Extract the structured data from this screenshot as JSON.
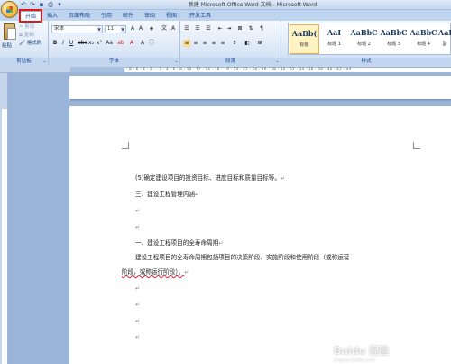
{
  "window": {
    "title": "新建 Microsoft Office Word 文档 - Microsoft Word"
  },
  "quick_access": [
    "undo-icon",
    "redo-icon",
    "save-icon",
    "print-icon",
    "customize-icon"
  ],
  "tabs": [
    {
      "label": "开始",
      "active": true
    },
    {
      "label": "插入"
    },
    {
      "label": "页面布局"
    },
    {
      "label": "引用"
    },
    {
      "label": "邮件"
    },
    {
      "label": "审阅"
    },
    {
      "label": "视图"
    },
    {
      "label": "开发工具"
    }
  ],
  "ribbon": {
    "clipboard": {
      "label": "剪贴板",
      "paste": "粘贴",
      "cut": "剪切",
      "copy": "复制",
      "format_painter": "格式刷"
    },
    "font": {
      "label": "字体",
      "font_name": "宋体",
      "font_size": "11"
    },
    "paragraph": {
      "label": "段落"
    },
    "styles": {
      "label": "样式",
      "items": [
        {
          "sample": "AaBb(",
          "name": "标题"
        },
        {
          "sample": "AaI",
          "name": "标题 1"
        },
        {
          "sample": "AaBbC",
          "name": "标题 2"
        },
        {
          "sample": "AaBbC",
          "name": "标题 3"
        },
        {
          "sample": "AaBbC",
          "name": "标题 4"
        },
        {
          "sample": "AaBb(",
          "name": "副"
        }
      ]
    }
  },
  "ruler_ticks": "· 8 · 6 · 4 · 2 ·  · 2 · 4 · 6 · 8 · 10 · 12 · 14 · 16 · 18 · 20 · 22 · 24 · 26 · 28 · 30 · 32 · 34 · 36 · 38 · 40 · 42 · 44",
  "document": {
    "paragraphs": [
      "(5)确定建设项目的投资目标、进度目标和质量目标等。",
      "三、建设工程管理内涵",
      "",
      "",
      "一、建设工程项目的全寿命周期",
      "建设工程项目的全寿命周期包括项目的决策阶段、实施阶段和使用阶段（或称运营",
      "阶段，或称运行阶段）。",
      "",
      "",
      "",
      ""
    ],
    "para_mark": "↵"
  },
  "watermark": {
    "text": "Baidu 经验",
    "url": "jingyan.baidu.com"
  }
}
